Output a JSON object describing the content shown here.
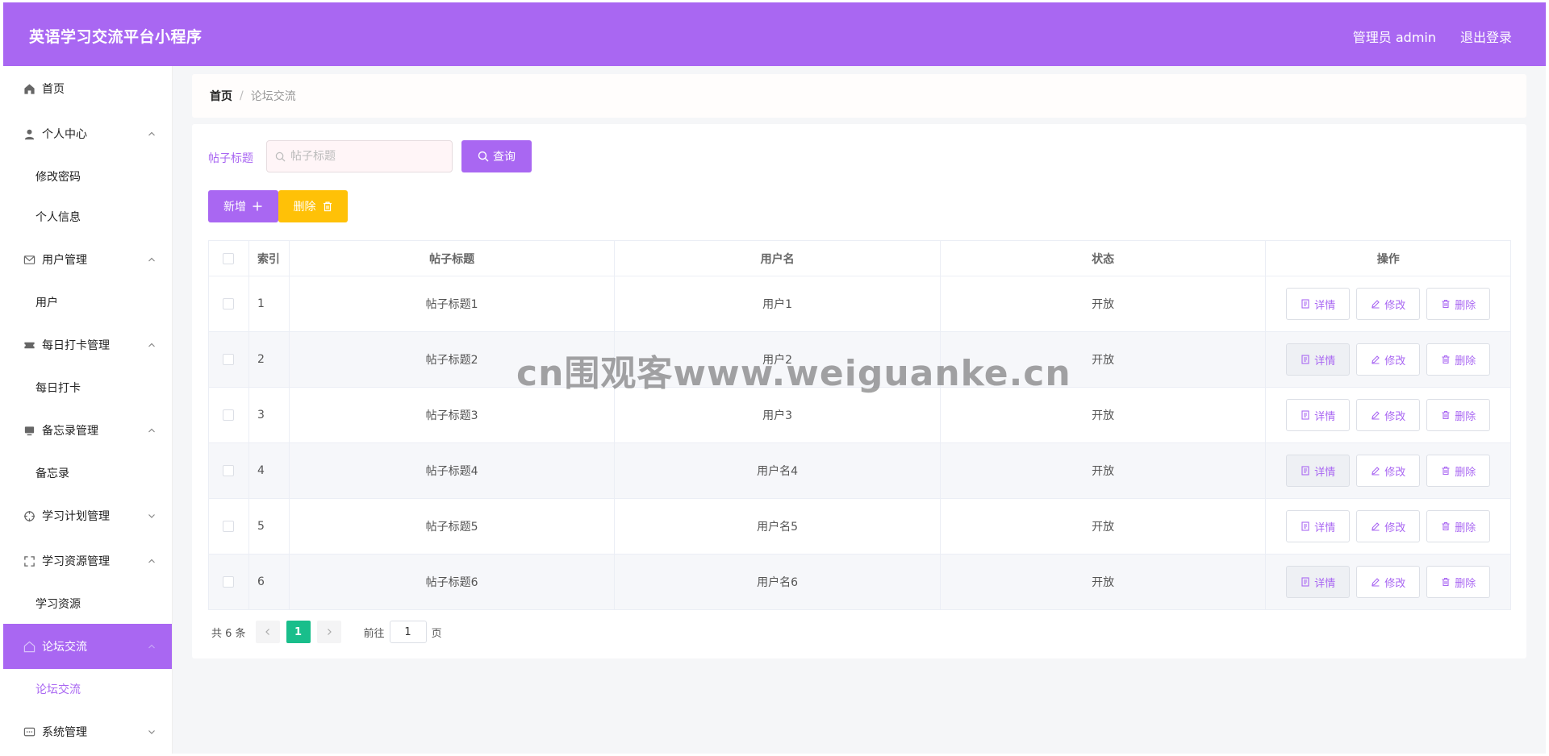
{
  "header": {
    "title": "英语学习交流平台小程序",
    "admin_label": "管理员 admin",
    "logout_label": "退出登录"
  },
  "sidebar": {
    "items": [
      {
        "label": "首页",
        "icon": "home-icon",
        "chevron": "none"
      },
      {
        "label": "个人中心",
        "icon": "user-icon",
        "chevron": "up"
      },
      {
        "label": "修改密码",
        "sub": true
      },
      {
        "label": "个人信息",
        "sub": true
      },
      {
        "label": "用户管理",
        "icon": "mail-icon",
        "chevron": "up"
      },
      {
        "label": "用户",
        "sub": true
      },
      {
        "label": "每日打卡管理",
        "icon": "ticket-icon",
        "chevron": "up"
      },
      {
        "label": "每日打卡",
        "sub": true
      },
      {
        "label": "备忘录管理",
        "icon": "monitor-icon",
        "chevron": "up"
      },
      {
        "label": "备忘录",
        "sub": true
      },
      {
        "label": "学习计划管理",
        "icon": "target-icon",
        "chevron": "down"
      },
      {
        "label": "学习资源管理",
        "icon": "fullscreen-icon",
        "chevron": "up"
      },
      {
        "label": "学习资源",
        "sub": true
      },
      {
        "label": "论坛交流",
        "icon": "chat-icon",
        "chevron": "up",
        "active": true
      },
      {
        "label": "论坛交流",
        "sub": true,
        "active": true
      },
      {
        "label": "系统管理",
        "icon": "message-icon",
        "chevron": "down"
      }
    ]
  },
  "breadcrumb": {
    "home": "首页",
    "separator": "/",
    "current": "论坛交流"
  },
  "search": {
    "label": "帖子标题",
    "placeholder": "帖子标题",
    "query_label": "查询"
  },
  "toolbar": {
    "add_label": "新增",
    "delete_label": "删除"
  },
  "table": {
    "headers": {
      "index": "索引",
      "title": "帖子标题",
      "user": "用户名",
      "status": "状态",
      "ops": "操作"
    },
    "rows": [
      {
        "index": "1",
        "title": "帖子标题1",
        "user": "用户1",
        "status": "开放"
      },
      {
        "index": "2",
        "title": "帖子标题2",
        "user": "用户2",
        "status": "开放"
      },
      {
        "index": "3",
        "title": "帖子标题3",
        "user": "用户3",
        "status": "开放"
      },
      {
        "index": "4",
        "title": "帖子标题4",
        "user": "用户名4",
        "status": "开放"
      },
      {
        "index": "5",
        "title": "帖子标题5",
        "user": "用户名5",
        "status": "开放"
      },
      {
        "index": "6",
        "title": "帖子标题6",
        "user": "用户名6",
        "status": "开放"
      }
    ],
    "row_actions": {
      "detail": "详情",
      "edit": "修改",
      "delete": "删除"
    }
  },
  "pagination": {
    "total_label": "共 6 条",
    "current_page": "1",
    "goto_label": "前往",
    "goto_value": "1",
    "page_suffix": "页"
  },
  "watermark": "cn围观客www.weiguanke.cn",
  "colors": {
    "accent": "#a967f2",
    "warning": "#ffc107",
    "page_active": "#19be8b"
  }
}
